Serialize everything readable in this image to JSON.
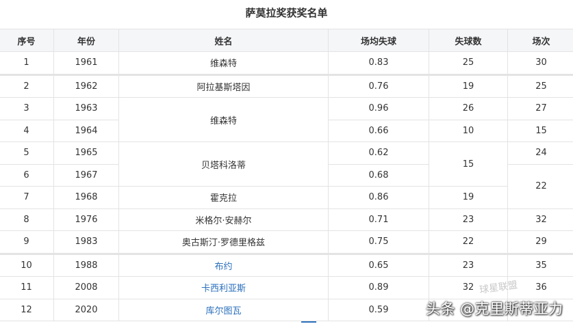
{
  "title": "萨莫拉奖获奖名单",
  "headers": [
    "序号",
    "年份",
    "姓名",
    "场均失球",
    "失球数",
    "场次"
  ],
  "rows": [
    {
      "index": "1",
      "year": "1961",
      "name": "维森特",
      "avg": "0.83",
      "conceded": "25",
      "matches": "30"
    },
    {
      "index": "2",
      "year": "1962",
      "name": "阿拉基斯塔因",
      "avg": "0.76",
      "conceded": "19",
      "matches": "25"
    },
    {
      "index": "3",
      "year": "1963",
      "name": "维森特",
      "avg": "0.96",
      "conceded": "26",
      "matches": "27"
    },
    {
      "index": "4",
      "year": "1964",
      "name": "维森特",
      "avg": "0.66",
      "conceded": "10",
      "matches": "15"
    },
    {
      "index": "5",
      "year": "1965",
      "name": "贝塔科洛蒂",
      "avg": "0.62",
      "conceded": "15",
      "matches": "24"
    },
    {
      "index": "6",
      "year": "1967",
      "name": "贝塔科洛蒂",
      "avg": "0.68",
      "conceded": "15",
      "matches": "22"
    },
    {
      "index": "7",
      "year": "1968",
      "name": "霍克拉",
      "avg": "0.86",
      "conceded": "19",
      "matches": "22"
    },
    {
      "index": "8",
      "year": "1976",
      "name": "米格尔·安赫尔",
      "avg": "0.71",
      "conceded": "23",
      "matches": "32"
    },
    {
      "index": "9",
      "year": "1983",
      "name": "奥古斯汀·罗德里格兹",
      "avg": "0.75",
      "conceded": "22",
      "matches": "29"
    },
    {
      "index": "10",
      "year": "1988",
      "name": "布约",
      "avg": "0.65",
      "conceded": "23",
      "matches": "35"
    },
    {
      "index": "11",
      "year": "2008",
      "name": "卡西利亚斯",
      "avg": "0.89",
      "conceded": "32",
      "matches": "36"
    },
    {
      "index": "12",
      "year": "2020",
      "name": "库尔图瓦",
      "avg": "0.59",
      "conceded": "",
      "matches": ""
    }
  ],
  "watermark": {
    "text": "头条 @克里斯蒂亚力",
    "faint_text": "球星联盟"
  },
  "colors": {
    "header_bg": "#f5f6f8",
    "border": "#e3e3e3",
    "link": "#2a6fbb",
    "text": "#333333"
  }
}
